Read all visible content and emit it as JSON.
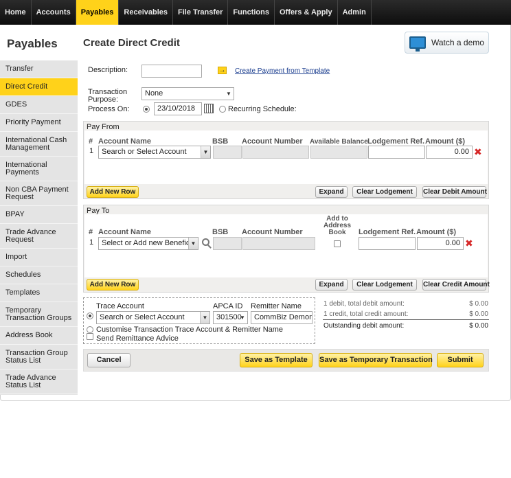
{
  "nav": {
    "items": [
      {
        "label": "Home",
        "name": "nav-home"
      },
      {
        "label": "Accounts",
        "name": "nav-accounts"
      },
      {
        "label": "Payables",
        "name": "nav-payables",
        "active": true
      },
      {
        "label": "Receivables",
        "name": "nav-receivables"
      },
      {
        "label": "File Transfer",
        "name": "nav-file-transfer"
      },
      {
        "label": "Functions",
        "name": "nav-functions"
      },
      {
        "label": "Offers & Apply",
        "name": "nav-offers-apply"
      },
      {
        "label": "Admin",
        "name": "nav-admin"
      }
    ]
  },
  "sidebar": {
    "title": "Payables",
    "items": [
      {
        "label": "Transfer"
      },
      {
        "label": "Direct Credit",
        "active": true
      },
      {
        "label": "GDES"
      },
      {
        "label": "Priority Payment"
      },
      {
        "label": "International Cash Management"
      },
      {
        "label": "International Payments"
      },
      {
        "label": "Non CBA Payment Request"
      },
      {
        "label": "BPAY"
      },
      {
        "label": "Trade Advance Request"
      },
      {
        "label": "Import"
      },
      {
        "label": "Schedules"
      },
      {
        "label": "Templates"
      },
      {
        "label": "Temporary Transaction Groups"
      },
      {
        "label": "Address Book"
      },
      {
        "label": "Transaction Group Status List"
      },
      {
        "label": "Trade Advance Status List"
      }
    ]
  },
  "page": {
    "title": "Create Direct Credit",
    "watch_demo": "Watch a demo"
  },
  "form": {
    "description_label": "Description:",
    "description_value": "",
    "template_link": "Create Payment from Template",
    "purpose_label_1": "Transaction",
    "purpose_label_2": "Purpose:",
    "purpose_value": "None",
    "process_on_label": "Process On:",
    "process_on_value": "23/10/2018",
    "recurring_label": "Recurring Schedule:"
  },
  "pay_from": {
    "heading": "Pay From",
    "columns": {
      "num": "#",
      "account_name": "Account Name",
      "bsb": "BSB",
      "account_number": "Account Number",
      "available_balance": "Available Balance",
      "lodgement_ref": "Lodgement Ref.",
      "amount": "Amount ($)"
    },
    "row": {
      "num": "1",
      "account_placeholder": "Search or Select Account",
      "amount": "0.00"
    },
    "buttons": {
      "add_row": "Add New Row",
      "expand": "Expand",
      "clear_lodgement": "Clear Lodgement",
      "clear_amount": "Clear Debit Amount"
    }
  },
  "pay_to": {
    "heading": "Pay To",
    "columns": {
      "num": "#",
      "account_name": "Account Name",
      "bsb": "BSB",
      "account_number": "Account Number",
      "add_to_book": "Add to Address Book",
      "lodgement_ref": "Lodgement Ref.",
      "amount": "Amount ($)"
    },
    "row": {
      "num": "1",
      "account_placeholder": "Select or Add new Beneficiar",
      "amount": "0.00"
    },
    "buttons": {
      "add_row": "Add New Row",
      "expand": "Expand",
      "clear_lodgement": "Clear Lodgement",
      "clear_amount": "Clear Credit Amount"
    }
  },
  "trace": {
    "trace_account_label": "Trace Account",
    "apca_label": "APCA ID",
    "remitter_label": "Remitter Name",
    "trace_account_value": "Search or Select Account",
    "apca_value": "301500",
    "remitter_value": "CommBiz Demonstr",
    "customise_label": "Customise Transaction Trace Account & Remitter Name",
    "remittance_label": "Send Remittance Advice"
  },
  "summary": {
    "debit_label": "1 debit, total debit amount:",
    "debit_value": "$ 0.00",
    "credit_label": "1 credit, total credit amount:",
    "credit_value": "$ 0.00",
    "outstanding_label": "Outstanding debit amount:",
    "outstanding_value": "$ 0.00"
  },
  "actions": {
    "cancel": "Cancel",
    "save_template": "Save as Template",
    "save_temp": "Save as Temporary Transaction",
    "submit": "Submit"
  }
}
